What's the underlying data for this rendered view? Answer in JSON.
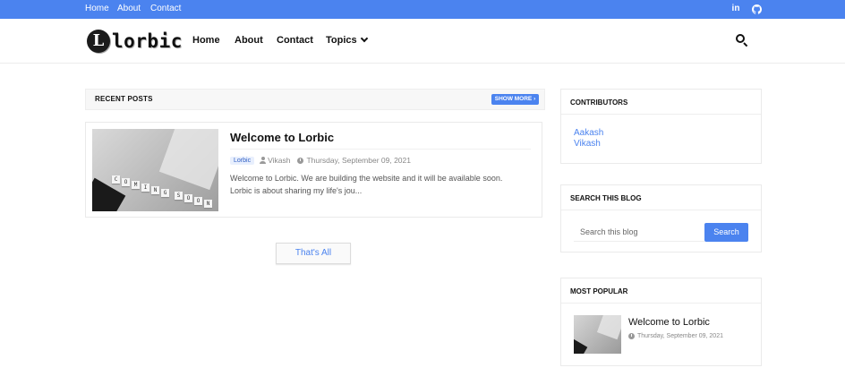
{
  "topbar": {
    "links": [
      "Home",
      "About",
      "Contact"
    ],
    "social": [
      "linkedin-icon",
      "github-icon"
    ],
    "color": "#4b83ef"
  },
  "header": {
    "logo_text": "lorbic",
    "logo_letter": "L",
    "nav": [
      "Home",
      "About",
      "Contact",
      "Topics"
    ],
    "search_icon": "search-icon"
  },
  "main": {
    "section_title": "RECENT POSTS",
    "show_more": "SHOW MORE",
    "posts": [
      {
        "title": "Welcome to Lorbic",
        "label": "Lorbic",
        "author": "Vikash",
        "date": "Thursday, September 09, 2021",
        "snippet": "Welcome to Lorbic. We are building the website and it will be available soon. Lorbic is about sharing my life's jou...",
        "thumb_text": [
          "C",
          "O",
          "M",
          "I",
          "N",
          "G",
          "S",
          "O",
          "O",
          "N"
        ]
      }
    ],
    "end_button": "That's All"
  },
  "sidebar": {
    "contributors": {
      "title": "CONTRIBUTORS",
      "names": [
        "Aakash",
        "Vikash"
      ]
    },
    "search": {
      "title": "SEARCH THIS BLOG",
      "placeholder": "Search this blog",
      "button": "Search"
    },
    "popular": {
      "title": "MOST POPULAR",
      "post_title": "Welcome to Lorbic",
      "post_date": "Thursday, September 09, 2021"
    }
  }
}
